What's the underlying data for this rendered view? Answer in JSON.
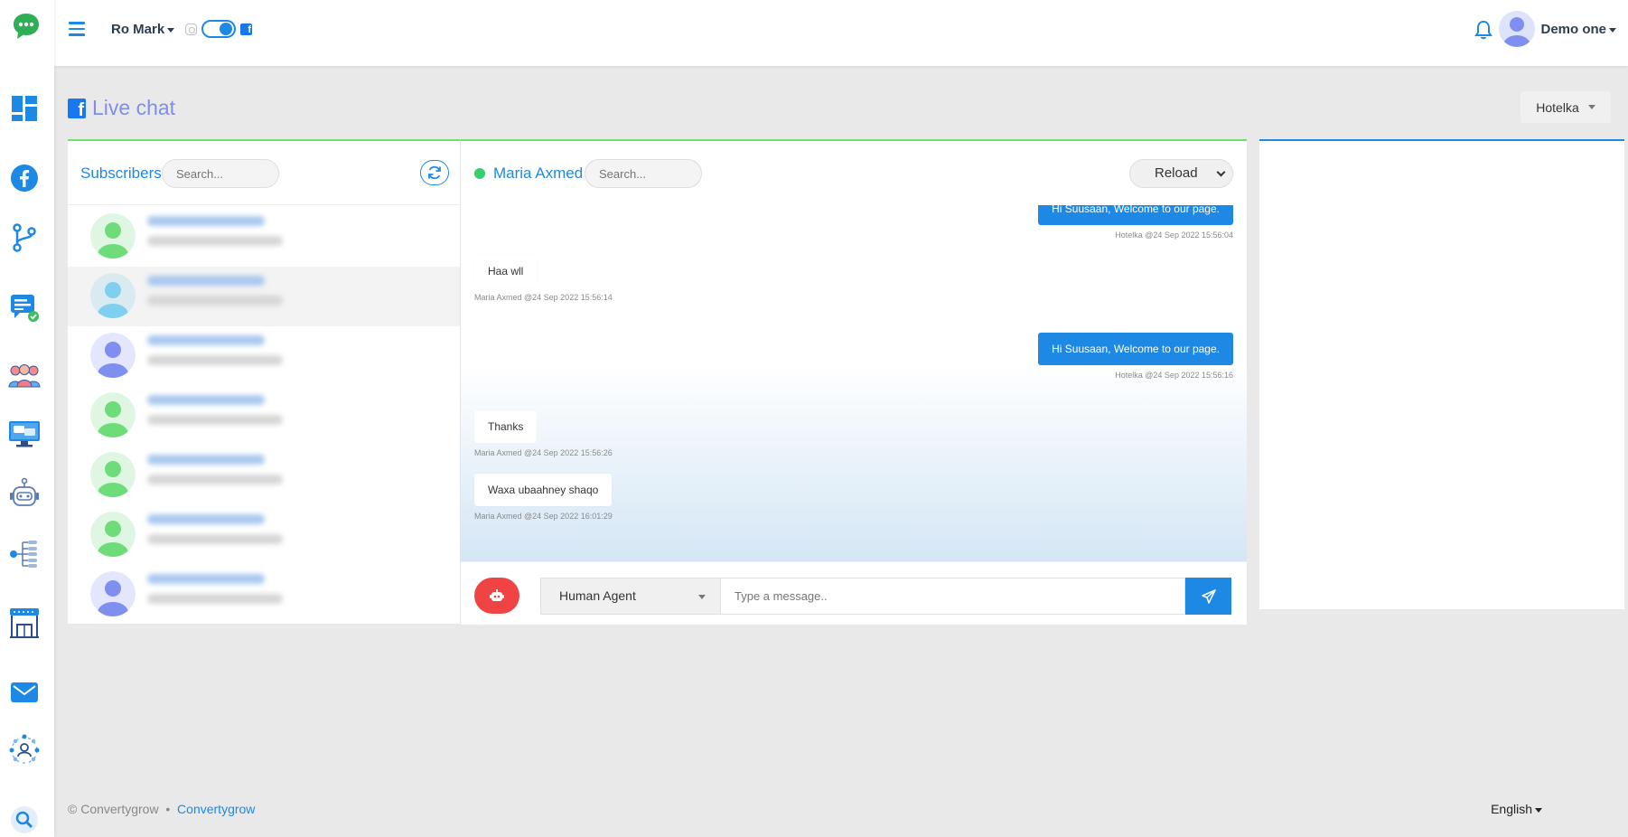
{
  "topbar": {
    "account_name": "Ro Mark",
    "user_name": "Demo one"
  },
  "page": {
    "title": "Live chat",
    "page_selector": "Hotelka"
  },
  "subscribers": {
    "title": "Subscribers",
    "search_placeholder": "Search...",
    "items": [
      {
        "avatar_color": "#6fdc7a",
        "active": false
      },
      {
        "avatar_color": "#7fd0ee",
        "active": true
      },
      {
        "avatar_color": "#7f8ff0",
        "active": false
      },
      {
        "avatar_color": "#6fdc7a",
        "active": false
      },
      {
        "avatar_color": "#6fdc7a",
        "active": false
      },
      {
        "avatar_color": "#6fdc7a",
        "active": false
      },
      {
        "avatar_color": "#7f8ff0",
        "active": false
      }
    ]
  },
  "chat": {
    "contact_name": "Maria Axmed",
    "search_placeholder": "Search...",
    "reload_label": "Reload",
    "messages": [
      {
        "direction": "out",
        "text": "Hi Suusaan, Welcome to our page.",
        "meta": "Hotelka @24 Sep 2022 15:56:04"
      },
      {
        "direction": "in",
        "text": "Haa wll",
        "meta": "Maria Axmed @24 Sep 2022 15:56:14"
      },
      {
        "direction": "out",
        "text": "Hi Suusaan, Welcome to our page.",
        "meta": "Hotelka @24 Sep 2022 15:56:16"
      },
      {
        "direction": "in",
        "text": "Thanks",
        "meta": "Maria Axmed @24 Sep 2022 15:56:26"
      },
      {
        "direction": "in",
        "text": "Waxa ubaahney shaqo",
        "meta": "Maria Axmed @24 Sep 2022 16:01:29"
      }
    ],
    "agent_select": "Human Agent",
    "input_placeholder": "Type a message.."
  },
  "footer": {
    "copyright": "© Convertygrow",
    "separator": "•",
    "link": "Convertygrow",
    "language": "English"
  },
  "colors": {
    "primary": "#1e88e5",
    "accent_green": "#6ee06e",
    "online": "#35d06b",
    "bot_button": "#f04444",
    "title_purple": "#7f8ee8"
  }
}
